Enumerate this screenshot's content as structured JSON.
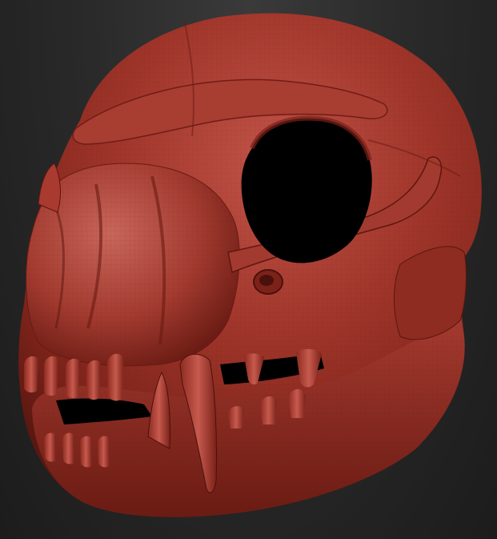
{
  "viewport": {
    "background_top": "#3a3a3a",
    "background_bottom": "#1c1c1c"
  },
  "model": {
    "subject": "skull-sculpt",
    "material_base": "#9a2d22",
    "material_highlight": "#c8564a",
    "material_shadow": "#4a110c",
    "cavity_color": "#000000"
  }
}
